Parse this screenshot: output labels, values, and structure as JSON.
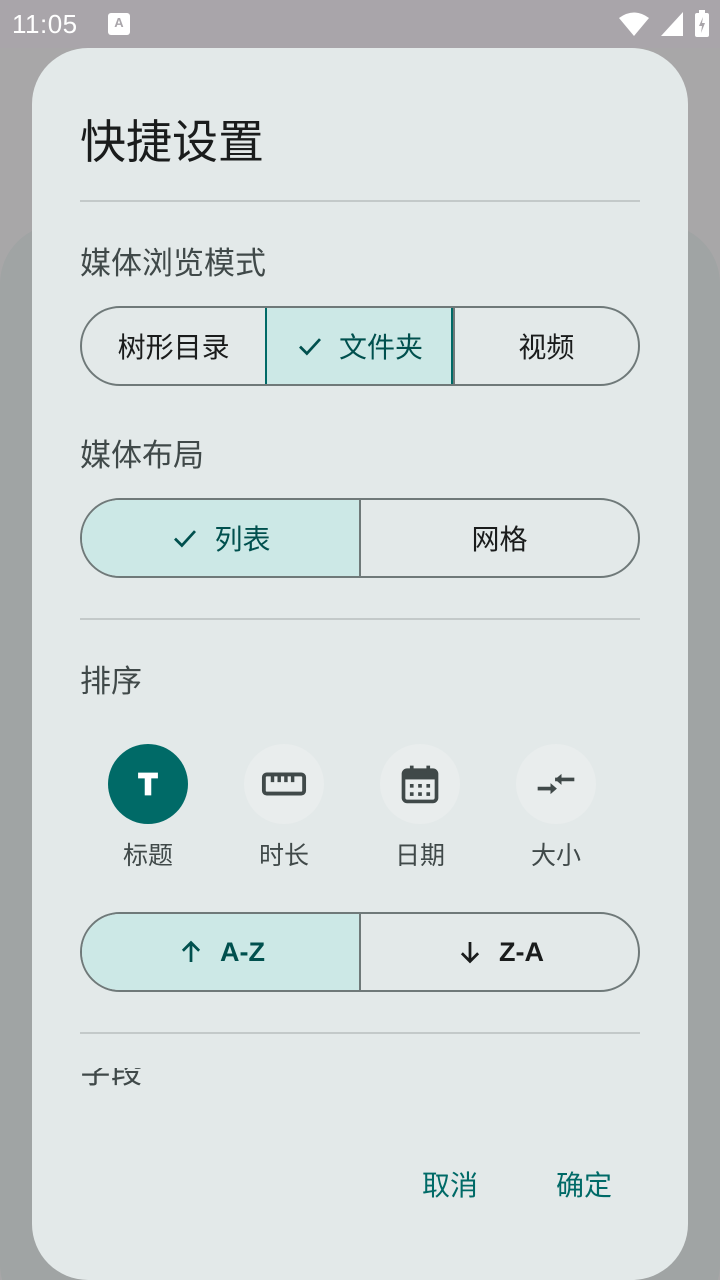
{
  "status_bar": {
    "time": "11:05",
    "notification_glyph": "A"
  },
  "dialog": {
    "title": "快捷设置",
    "media_mode": {
      "label": "媒体浏览模式",
      "options": [
        "树形目录",
        "文件夹",
        "视频"
      ],
      "selected": "文件夹"
    },
    "media_layout": {
      "label": "媒体布局",
      "options": [
        "列表",
        "网格"
      ],
      "selected": "列表"
    },
    "sort": {
      "label": "排序",
      "items": [
        {
          "label": "标题",
          "icon": "title-t-icon"
        },
        {
          "label": "时长",
          "icon": "ruler-icon"
        },
        {
          "label": "日期",
          "icon": "calendar-icon"
        },
        {
          "label": "大小",
          "icon": "compare-arrows-icon"
        }
      ],
      "selected": "标题",
      "order": {
        "options": [
          "A-Z",
          "Z-A"
        ],
        "selected": "A-Z"
      }
    },
    "next_section_partial": "字段",
    "buttons": {
      "cancel": "取消",
      "confirm": "确定"
    }
  },
  "colors": {
    "accent": "#006a67",
    "selected_bg": "#cce8e6",
    "surface": "#e3e9e9"
  }
}
